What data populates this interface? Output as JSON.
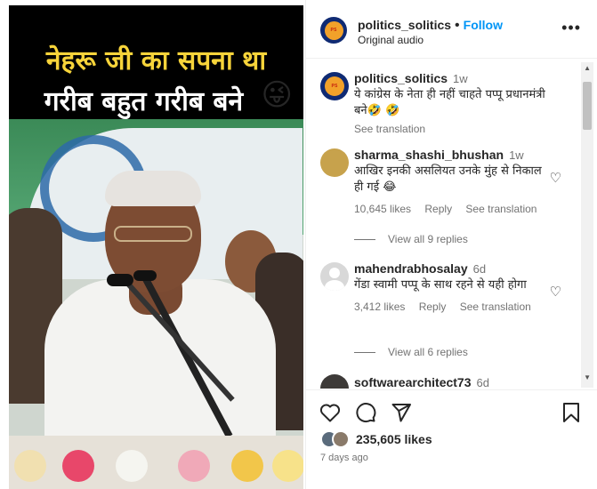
{
  "video": {
    "caption_line1": "नेहरू जी का सपना था",
    "caption_line2": "गरीब बहुत गरीब बने",
    "caption_emoji": "😜"
  },
  "header": {
    "username": "politics_solitics",
    "separator": "•",
    "follow_label": "Follow",
    "audio_label": "Original audio",
    "more_icon": "more-horizontal-icon"
  },
  "comments": [
    {
      "username": "politics_solitics",
      "time": "1w",
      "text": "ये कांग्रेस के नेता ही नहीं चाहते पप्पू प्रधानमंत्री बने🤣 🤣",
      "see_translation": "See translation"
    },
    {
      "username": "sharma_shashi_bhushan",
      "time": "1w",
      "text": "आखिर इनकी असलियत उनके मुंह से निकाल ही गई 😂",
      "likes": "10,645 likes",
      "reply": "Reply",
      "see_translation": "See translation",
      "view_replies": "View all 9 replies"
    },
    {
      "username": "mahendrabhosalay",
      "time": "6d",
      "text": "गेंडा स्वामी पप्पू के साथ रहने से यही होगा",
      "likes": "3,412 likes",
      "reply": "Reply",
      "see_translation": "See translation",
      "view_replies": "View all 6 replies"
    },
    {
      "username": "softwarearchitect73",
      "time": "6d"
    }
  ],
  "actions": {
    "like_icon": "heart-icon",
    "comment_icon": "comment-icon",
    "share_icon": "share-icon",
    "save_icon": "bookmark-icon",
    "likes_count": "235,605 likes",
    "time_ago": "7 days ago"
  },
  "colors": {
    "accent": "#0095f6",
    "text": "#262626",
    "muted": "#737373"
  }
}
